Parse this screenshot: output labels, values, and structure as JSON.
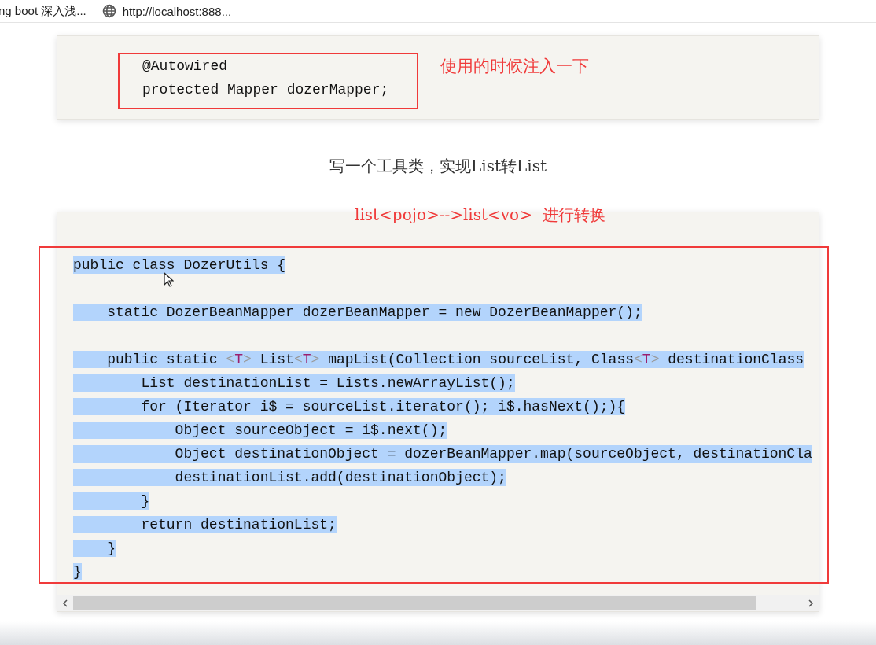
{
  "tabs": [
    {
      "kind": "text",
      "label": "ng boot 深入浅..."
    },
    {
      "kind": "site",
      "label": "http://localhost:888..."
    }
  ],
  "snippet": {
    "lines": [
      "@Autowired",
      "protected Mapper dozerMapper;"
    ],
    "note": "使用的时候注入一下"
  },
  "caption": "写一个工具类，实现List转List",
  "code_block": {
    "note": "list<pojo>-->list<vo>  进行转换",
    "lines": [
      {
        "selected": true,
        "blank_after": true,
        "parts": [
          {
            "kind": "plain",
            "text": "public class DozerUtils {"
          }
        ]
      },
      {
        "selected": true,
        "blank_after": true,
        "parts": [
          {
            "kind": "plain",
            "text": "    static DozerBeanMapper dozerBeanMapper = new DozerBeanMapper();"
          }
        ]
      },
      {
        "selected": true,
        "parts": [
          {
            "kind": "plain",
            "text": "    public static "
          },
          {
            "kind": "bracket",
            "text": "<"
          },
          {
            "kind": "type",
            "text": "T"
          },
          {
            "kind": "bracket",
            "text": ">"
          },
          {
            "kind": "plain",
            "text": " List"
          },
          {
            "kind": "bracket",
            "text": "<"
          },
          {
            "kind": "type",
            "text": "T"
          },
          {
            "kind": "bracket",
            "text": ">"
          },
          {
            "kind": "plain",
            "text": " mapList(Collection sourceList, Class"
          },
          {
            "kind": "bracket",
            "text": "<"
          },
          {
            "kind": "type",
            "text": "T"
          },
          {
            "kind": "bracket",
            "text": ">"
          },
          {
            "kind": "plain",
            "text": " destinationClass"
          }
        ]
      },
      {
        "selected": true,
        "parts": [
          {
            "kind": "plain",
            "text": "        List destinationList = Lists.newArrayList();"
          }
        ]
      },
      {
        "selected": true,
        "parts": [
          {
            "kind": "plain",
            "text": "        for (Iterator i$ = sourceList.iterator(); i$.hasNext();){"
          }
        ]
      },
      {
        "selected": true,
        "parts": [
          {
            "kind": "plain",
            "text": "            Object sourceObject = i$.next();"
          }
        ]
      },
      {
        "selected": true,
        "parts": [
          {
            "kind": "plain",
            "text": "            Object destinationObject = dozerBeanMapper.map(sourceObject, destinationCla"
          }
        ]
      },
      {
        "selected": true,
        "parts": [
          {
            "kind": "plain",
            "text": "            destinationList.add(destinationObject);"
          }
        ]
      },
      {
        "selected": true,
        "parts": [
          {
            "kind": "plain",
            "text": "        }"
          }
        ]
      },
      {
        "selected": true,
        "parts": [
          {
            "kind": "plain",
            "text": "        return destinationList;"
          }
        ]
      },
      {
        "selected": true,
        "parts": [
          {
            "kind": "plain",
            "text": "    }"
          }
        ]
      },
      {
        "selected": true,
        "parts": [
          {
            "kind": "plain",
            "text": "}"
          }
        ]
      }
    ]
  }
}
